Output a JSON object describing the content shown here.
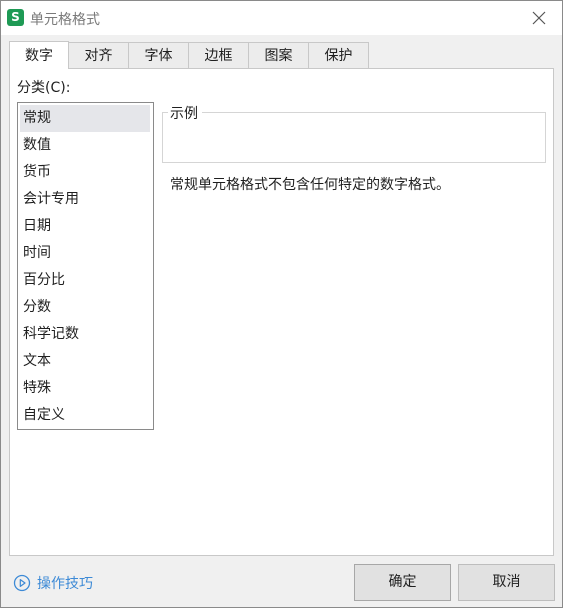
{
  "window": {
    "app_icon_letter": "S",
    "title": "单元格格式"
  },
  "tabs": [
    {
      "label": "数字",
      "active": true
    },
    {
      "label": "对齐"
    },
    {
      "label": "字体"
    },
    {
      "label": "边框"
    },
    {
      "label": "图案"
    },
    {
      "label": "保护"
    }
  ],
  "category": {
    "label": "分类(C):",
    "items": [
      "常规",
      "数值",
      "货币",
      "会计专用",
      "日期",
      "时间",
      "百分比",
      "分数",
      "科学记数",
      "文本",
      "特殊",
      "自定义"
    ],
    "selected": "常规"
  },
  "sample": {
    "legend": "示例",
    "value": ""
  },
  "description": "常规单元格格式不包含任何特定的数字格式。",
  "footer": {
    "tips_label": "操作技巧",
    "ok_label": "确定",
    "cancel_label": "取消"
  },
  "colors": {
    "brand_green": "#1e9a55",
    "link_blue": "#3d8ad6",
    "selection_bg": "#e5e6ea"
  }
}
